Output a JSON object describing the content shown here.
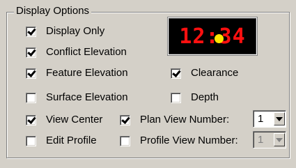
{
  "group": {
    "title": "Display Options"
  },
  "clock": {
    "display": "12:34"
  },
  "options": {
    "display_only": {
      "label": "Display Only",
      "checked": true
    },
    "conflict_elevation": {
      "label": "Conflict Elevation",
      "checked": true
    },
    "feature_elevation": {
      "label": "Feature Elevation",
      "checked": true
    },
    "clearance": {
      "label": "Clearance",
      "checked": true
    },
    "surface_elevation": {
      "label": "Surface Elevation",
      "checked": false
    },
    "depth": {
      "label": "Depth",
      "checked": false
    },
    "view_center": {
      "label": "View Center",
      "checked": true
    },
    "plan_view_number": {
      "label": "Plan View Number:",
      "checked": true
    },
    "edit_profile": {
      "label": "Edit Profile",
      "checked": false
    },
    "profile_view_number": {
      "label": "Profile View Number:",
      "checked": false,
      "label_disabled": true
    }
  },
  "selects": {
    "plan_view_number": {
      "value": "1",
      "enabled": true
    },
    "profile_view_number": {
      "value": "1",
      "enabled": false
    }
  }
}
